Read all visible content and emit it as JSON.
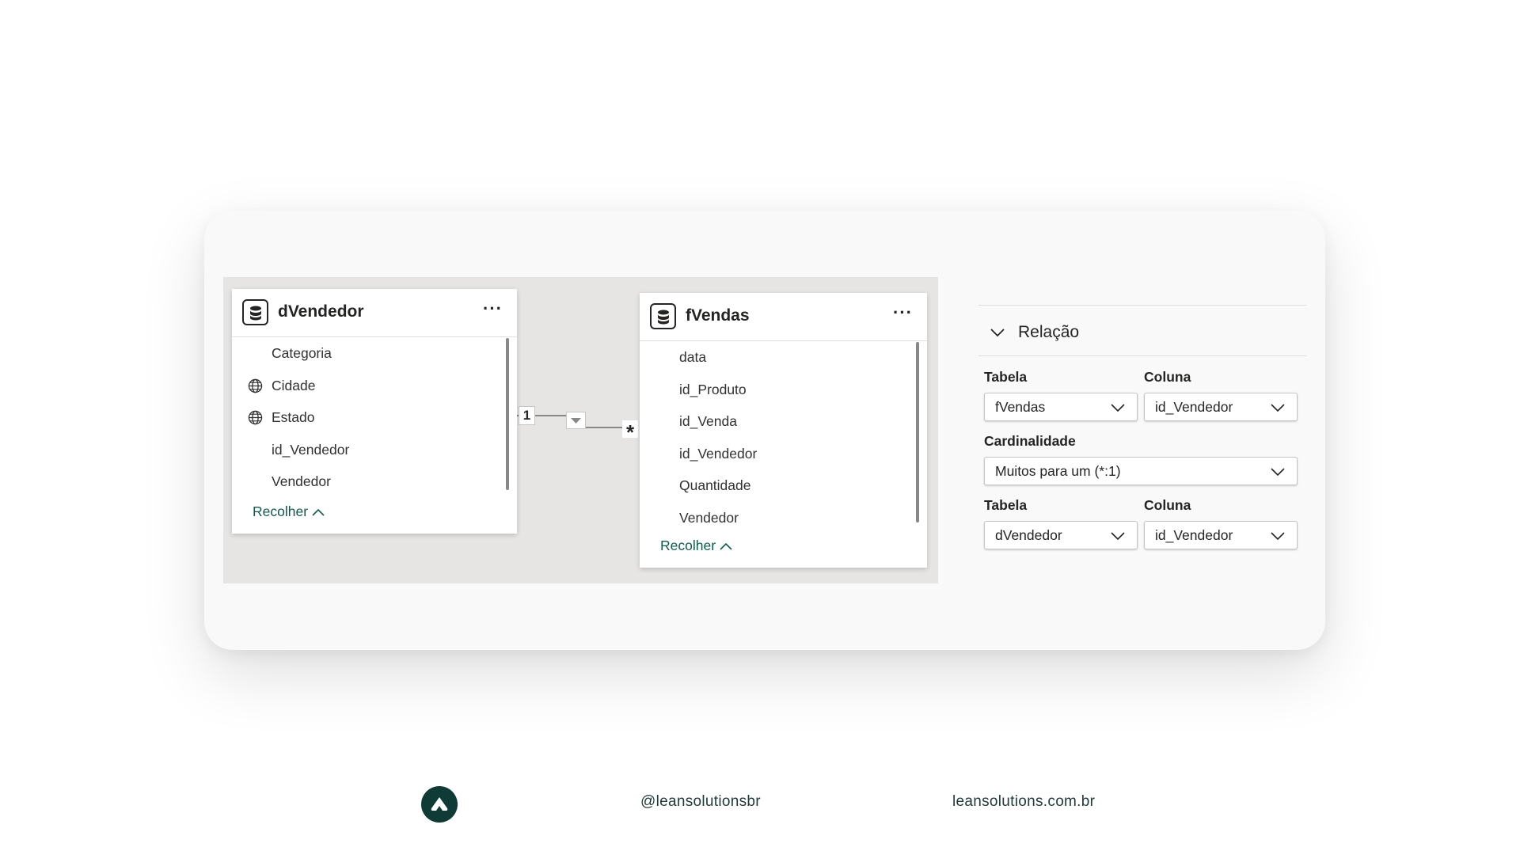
{
  "diagram": {
    "tables": [
      {
        "name": "dVendedor",
        "fields": [
          {
            "label": "Categoria",
            "icon": ""
          },
          {
            "label": "Cidade",
            "icon": "globe-icon"
          },
          {
            "label": "Estado",
            "icon": "globe-icon"
          },
          {
            "label": "id_Vendedor",
            "icon": ""
          },
          {
            "label": "Vendedor",
            "icon": ""
          }
        ],
        "collapse_label": "Recolher",
        "more_label": "···"
      },
      {
        "name": "fVendas",
        "fields": [
          {
            "label": "data",
            "icon": ""
          },
          {
            "label": "id_Produto",
            "icon": ""
          },
          {
            "label": "id_Venda",
            "icon": ""
          },
          {
            "label": "id_Vendedor",
            "icon": ""
          },
          {
            "label": "Quantidade",
            "icon": ""
          },
          {
            "label": "Vendedor",
            "icon": ""
          }
        ],
        "collapse_label": "Recolher",
        "more_label": "···"
      }
    ],
    "relationship": {
      "one_side_label": "1",
      "many_side_label": "*"
    }
  },
  "panel": {
    "section_title": "Relação",
    "from_table_label": "Tabela",
    "from_table_value": "fVendas",
    "from_column_label": "Coluna",
    "from_column_value": "id_Vendedor",
    "cardinality_label": "Cardinalidade",
    "cardinality_value": "Muitos para um (*:1)",
    "to_table_label": "Tabela",
    "to_table_value": "dVendedor",
    "to_column_label": "Coluna",
    "to_column_value": "id_Vendedor"
  },
  "footer": {
    "logo_icon": "lean-solutions-logo-icon",
    "handle": "@leansolutionsbr",
    "website": "leansolutions.com.br"
  },
  "colors": {
    "accent": "#0e5c4d",
    "logo_bg": "#0e3b35",
    "canvas_bg": "#e6e5e4"
  }
}
